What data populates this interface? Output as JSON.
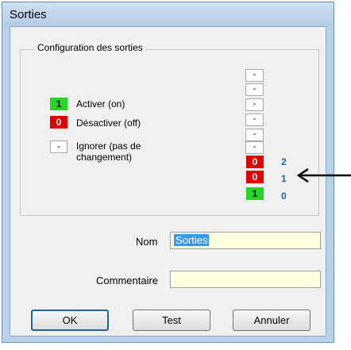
{
  "window": {
    "title": "Sorties"
  },
  "group": {
    "title": "Configuration des sorties",
    "legend": [
      {
        "symbol": "1",
        "label": "Activer (on)"
      },
      {
        "symbol": "0",
        "label": "Désactiver (off)"
      },
      {
        "symbol": "-",
        "label": "Ignorer (pas de changement)"
      }
    ],
    "outputs": [
      {
        "value": "-"
      },
      {
        "value": "-"
      },
      {
        "value": "-"
      },
      {
        "value": "-"
      },
      {
        "value": "-"
      },
      {
        "value": "-"
      },
      {
        "value": "0",
        "index": "2"
      },
      {
        "value": "0",
        "index": "1"
      },
      {
        "value": "1",
        "index": "0"
      }
    ]
  },
  "form": {
    "name_label": "Nom",
    "name_value": "Sorties",
    "comment_label": "Commentaire",
    "comment_value": ""
  },
  "buttons": {
    "ok": "OK",
    "test": "Test",
    "cancel": "Annuler"
  },
  "colors": {
    "on": "#22d822",
    "off": "#e00000",
    "index": "#2060c8",
    "input_bg": "#ffffe0",
    "selection": "#3399ff"
  }
}
